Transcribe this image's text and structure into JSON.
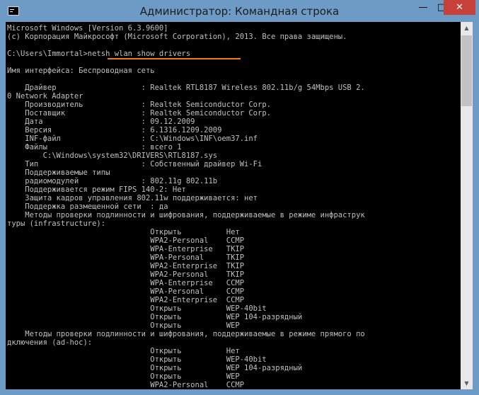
{
  "window": {
    "title": "Администратор: Командная строка",
    "minimize_glyph": "—",
    "maximize_glyph": "□",
    "close_glyph": "✕",
    "icon": "cmd-icon"
  },
  "colors": {
    "console_bg": "#000000",
    "console_text": "#c0c0c0",
    "highlight": "#f27b20",
    "titlebar": "#6e9bc6",
    "close_button": "#c7403a"
  },
  "console": {
    "lines": [
      "Microsoft Windows [Version 6.3.9600]",
      "(c) Корпорация Майкрософт (Microsoft Corporation), 2013. Все права защищены.",
      "",
      "C:\\Users\\Immortal>netsh wlan show drivers",
      "",
      "Имя интерфейса: Беспроводная сеть",
      "",
      "    Драйвер                   : Realtek RTL8187 Wireless 802.11b/g 54Mbps USB 2.",
      "0 Network Adapter",
      "    Производитель             : Realtek Semiconductor Corp.",
      "    Поставщик                 : Realtek Semiconductor Corp.",
      "    Дата                      : 09.12.2009",
      "    Версия                    : 6.1316.1209.2009",
      "    INF-файл                  : C:\\Windows\\INF\\oem37.inf",
      "    Файлы                     : всего 1",
      "        C:\\Windows\\system32\\DRIVERS\\RTL8187.sys",
      "    Тип                       : Собственный драйвер Wi-Fi",
      "    Поддерживаемые типы",
      "    радиомодулей              : 802.11g 802.11b",
      "    Поддерживается режим FIPS 140-2: Нет",
      "    Защита кадров управления 802.11w поддерживается: нет",
      "    Поддержка размещенной сети  : да",
      "    Методы проверки подлинности и шифрования, поддерживаемые в режиме инфраструк",
      "туры (infrastructure):",
      "                                Открыть          Нет",
      "                                WPA2-Personal    CCMP",
      "                                WPA-Enterprise   TKIP",
      "                                WPA-Personal     TKIP",
      "                                WPA2-Enterprise  TKIP",
      "                                WPA2-Personal    TKIP",
      "                                WPA-Enterprise   CCMP",
      "                                WPA-Personal     CCMP",
      "                                WPA2-Enterprise  CCMP",
      "                                Открыть          WEP-40bit",
      "                                Открыть          WEP 104-разрядный",
      "                                Открыть          WEP",
      "    Методы проверки подлинности и шифрования, поддерживаемые в режиме прямого по",
      "дключения (ad-hoc):",
      "                                Открыть          Нет",
      "                                Открыть          WEP-40bit",
      "                                Открыть          WEP 104-разрядный",
      "                                Открыть          WEP",
      "                                WPA2-Personal    CCMP"
    ]
  },
  "scrollbar": {
    "up_glyph": "▲",
    "down_glyph": "▼"
  }
}
